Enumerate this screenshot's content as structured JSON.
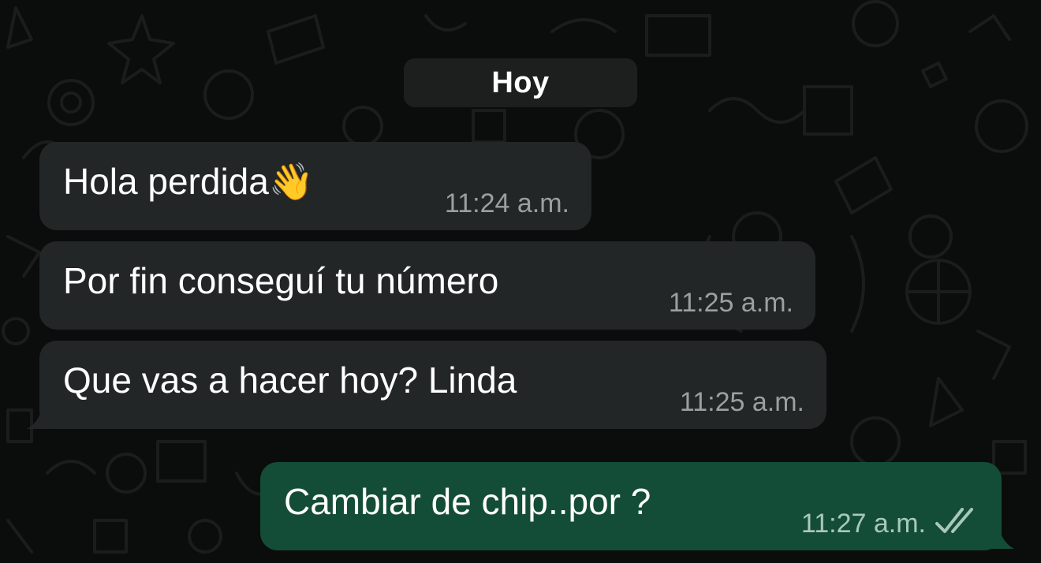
{
  "date_divider": "Hoy",
  "colors": {
    "background": "#0b0c0c",
    "incoming_bubble": "#232626",
    "outgoing_bubble": "#144d37",
    "doodle": "#1b1c1c",
    "read_ticks": "#a8c9ba"
  },
  "messages": [
    {
      "direction": "incoming",
      "text": "Hola perdida",
      "emoji": "👋",
      "time": "11:24 a.m."
    },
    {
      "direction": "incoming",
      "text": "Por fin conseguí tu número",
      "time": "11:25 a.m."
    },
    {
      "direction": "incoming",
      "text": "Que vas a hacer hoy? Linda",
      "time": "11:25 a.m."
    },
    {
      "direction": "outgoing",
      "text": "Cambiar de chip..por ?",
      "time": "11:27 a.m.",
      "status_icon": "double-check-icon"
    }
  ]
}
